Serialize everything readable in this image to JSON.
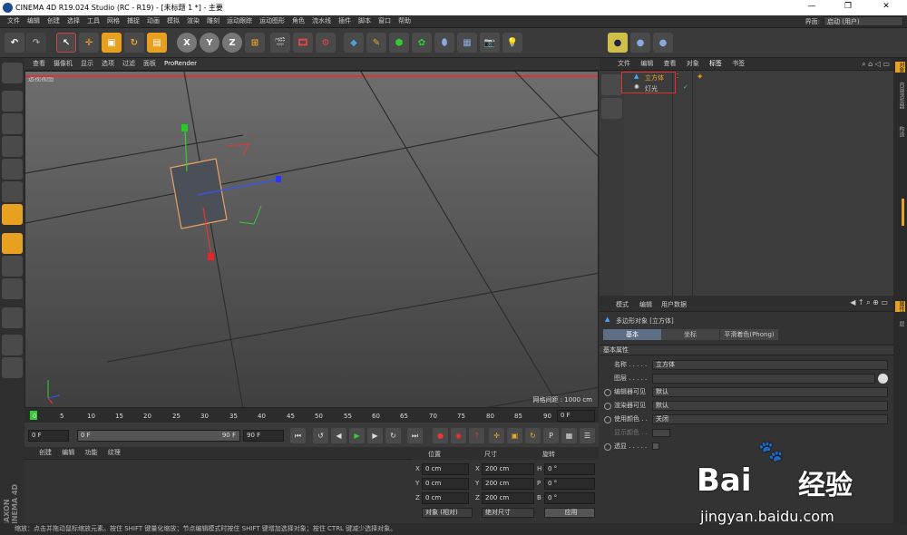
{
  "window": {
    "title": "CINEMA 4D R19.024 Studio (RC - R19) - [未标题 1 *] - 主要",
    "min": "—",
    "max": "❐",
    "close": "✕"
  },
  "menu": [
    "文件",
    "编辑",
    "创建",
    "选择",
    "工具",
    "网格",
    "捕捉",
    "动画",
    "模拟",
    "渲染",
    "雕刻",
    "运动跟踪",
    "运动图形",
    "角色",
    "流水线",
    "插件",
    "脚本",
    "窗口",
    "帮助"
  ],
  "layout": {
    "label": "界面:",
    "value": "启动 (用户)"
  },
  "toolbar": {
    "x": "X",
    "y": "Y",
    "z": "Z"
  },
  "viewport": {
    "menu": [
      "查看",
      "摄像机",
      "显示",
      "选项",
      "过滤",
      "面板",
      "ProRender"
    ],
    "camera": "透视视图",
    "grid_distance": "网格间距 : 1000 cm"
  },
  "timeline": {
    "ticks": [
      "0",
      "5",
      "10",
      "15",
      "20",
      "25",
      "30",
      "35",
      "40",
      "45",
      "50",
      "55",
      "60",
      "65",
      "70",
      "75",
      "80",
      "85",
      "90"
    ],
    "current": "0 F"
  },
  "playback": {
    "start": "0 F",
    "slider_start": "0 F",
    "slider_end": "90 F",
    "end": "90 F"
  },
  "material": {
    "menu": [
      "创建",
      "编辑",
      "功能",
      "纹理"
    ]
  },
  "coords": {
    "headers": [
      "位置",
      "尺寸",
      "旋转"
    ],
    "rows": [
      {
        "axis": "X",
        "pos": "0 cm",
        "sizeaxis": "X",
        "size": "200 cm",
        "rotaxis": "H",
        "rot": "0 °"
      },
      {
        "axis": "Y",
        "pos": "0 cm",
        "sizeaxis": "Y",
        "size": "200 cm",
        "rotaxis": "P",
        "rot": "0 °"
      },
      {
        "axis": "Z",
        "pos": "0 cm",
        "sizeaxis": "Z",
        "size": "200 cm",
        "rotaxis": "B",
        "rot": "0 °"
      }
    ],
    "mode": "对象 (相对)",
    "size_mode": "绝对尺寸",
    "apply": "应用"
  },
  "objects": {
    "menu": [
      "文件",
      "编辑",
      "查看",
      "对象",
      "标签",
      "书签"
    ],
    "items": [
      {
        "name": "立方体"
      },
      {
        "name": "灯光"
      }
    ]
  },
  "attributes": {
    "menu": [
      "模式",
      "编辑",
      "用户数据"
    ],
    "object_label": "多边形对象 [立方体]",
    "tabs": [
      "基本",
      "坐标",
      "平滑着色(Phong)"
    ],
    "section": "基本属性",
    "fields": [
      {
        "label": "名称 . . . . .",
        "value": "立方体"
      },
      {
        "label": "图层 . . . . .",
        "value": ""
      },
      {
        "label": "编辑器可见",
        "value": "默认"
      },
      {
        "label": "渲染器可见",
        "value": "默认"
      },
      {
        "label": "使用颜色 . .",
        "value": "关闭"
      },
      {
        "label": "显示颜色 . .",
        "value": ""
      },
      {
        "label": "透显 . . . . .",
        "value": ""
      }
    ]
  },
  "righttabs": [
    "对象",
    "内容浏览器",
    "构造",
    "属性",
    "层"
  ],
  "status": "缩放：点击并拖动鼠标缩放元素。按住 SHIFT 键量化缩放；节点编辑模式时按住 SHIFT 键增加选择对象；按住 CTRL 键减少选择对象。",
  "side_brand": "MAXON CINEMA 4D",
  "watermark": {
    "brand": "Bai",
    "brand2": "经验",
    "url": "jingyan.baidu.com"
  },
  "colors": {
    "highlight": "#e03030",
    "selected_tab": "#5b6e86",
    "accent": "#f5a623"
  }
}
